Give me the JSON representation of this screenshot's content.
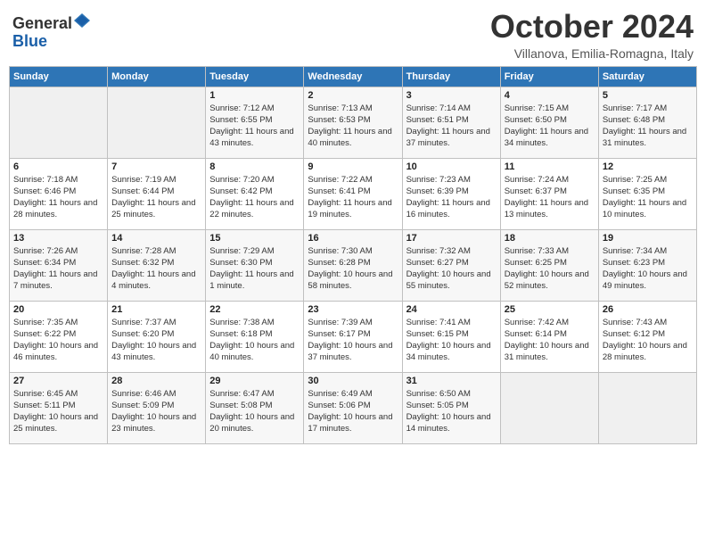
{
  "header": {
    "logo_general": "General",
    "logo_blue": "Blue",
    "month_title": "October 2024",
    "subtitle": "Villanova, Emilia-Romagna, Italy"
  },
  "weekdays": [
    "Sunday",
    "Monday",
    "Tuesday",
    "Wednesday",
    "Thursday",
    "Friday",
    "Saturday"
  ],
  "weeks": [
    [
      {
        "day": "",
        "empty": true
      },
      {
        "day": "",
        "empty": true
      },
      {
        "day": "1",
        "sunrise": "7:12 AM",
        "sunset": "6:55 PM",
        "daylight": "11 hours and 43 minutes."
      },
      {
        "day": "2",
        "sunrise": "7:13 AM",
        "sunset": "6:53 PM",
        "daylight": "11 hours and 40 minutes."
      },
      {
        "day": "3",
        "sunrise": "7:14 AM",
        "sunset": "6:51 PM",
        "daylight": "11 hours and 37 minutes."
      },
      {
        "day": "4",
        "sunrise": "7:15 AM",
        "sunset": "6:50 PM",
        "daylight": "11 hours and 34 minutes."
      },
      {
        "day": "5",
        "sunrise": "7:17 AM",
        "sunset": "6:48 PM",
        "daylight": "11 hours and 31 minutes."
      }
    ],
    [
      {
        "day": "6",
        "sunrise": "7:18 AM",
        "sunset": "6:46 PM",
        "daylight": "11 hours and 28 minutes."
      },
      {
        "day": "7",
        "sunrise": "7:19 AM",
        "sunset": "6:44 PM",
        "daylight": "11 hours and 25 minutes."
      },
      {
        "day": "8",
        "sunrise": "7:20 AM",
        "sunset": "6:42 PM",
        "daylight": "11 hours and 22 minutes."
      },
      {
        "day": "9",
        "sunrise": "7:22 AM",
        "sunset": "6:41 PM",
        "daylight": "11 hours and 19 minutes."
      },
      {
        "day": "10",
        "sunrise": "7:23 AM",
        "sunset": "6:39 PM",
        "daylight": "11 hours and 16 minutes."
      },
      {
        "day": "11",
        "sunrise": "7:24 AM",
        "sunset": "6:37 PM",
        "daylight": "11 hours and 13 minutes."
      },
      {
        "day": "12",
        "sunrise": "7:25 AM",
        "sunset": "6:35 PM",
        "daylight": "11 hours and 10 minutes."
      }
    ],
    [
      {
        "day": "13",
        "sunrise": "7:26 AM",
        "sunset": "6:34 PM",
        "daylight": "11 hours and 7 minutes."
      },
      {
        "day": "14",
        "sunrise": "7:28 AM",
        "sunset": "6:32 PM",
        "daylight": "11 hours and 4 minutes."
      },
      {
        "day": "15",
        "sunrise": "7:29 AM",
        "sunset": "6:30 PM",
        "daylight": "11 hours and 1 minute."
      },
      {
        "day": "16",
        "sunrise": "7:30 AM",
        "sunset": "6:28 PM",
        "daylight": "10 hours and 58 minutes."
      },
      {
        "day": "17",
        "sunrise": "7:32 AM",
        "sunset": "6:27 PM",
        "daylight": "10 hours and 55 minutes."
      },
      {
        "day": "18",
        "sunrise": "7:33 AM",
        "sunset": "6:25 PM",
        "daylight": "10 hours and 52 minutes."
      },
      {
        "day": "19",
        "sunrise": "7:34 AM",
        "sunset": "6:23 PM",
        "daylight": "10 hours and 49 minutes."
      }
    ],
    [
      {
        "day": "20",
        "sunrise": "7:35 AM",
        "sunset": "6:22 PM",
        "daylight": "10 hours and 46 minutes."
      },
      {
        "day": "21",
        "sunrise": "7:37 AM",
        "sunset": "6:20 PM",
        "daylight": "10 hours and 43 minutes."
      },
      {
        "day": "22",
        "sunrise": "7:38 AM",
        "sunset": "6:18 PM",
        "daylight": "10 hours and 40 minutes."
      },
      {
        "day": "23",
        "sunrise": "7:39 AM",
        "sunset": "6:17 PM",
        "daylight": "10 hours and 37 minutes."
      },
      {
        "day": "24",
        "sunrise": "7:41 AM",
        "sunset": "6:15 PM",
        "daylight": "10 hours and 34 minutes."
      },
      {
        "day": "25",
        "sunrise": "7:42 AM",
        "sunset": "6:14 PM",
        "daylight": "10 hours and 31 minutes."
      },
      {
        "day": "26",
        "sunrise": "7:43 AM",
        "sunset": "6:12 PM",
        "daylight": "10 hours and 28 minutes."
      }
    ],
    [
      {
        "day": "27",
        "sunrise": "6:45 AM",
        "sunset": "5:11 PM",
        "daylight": "10 hours and 25 minutes."
      },
      {
        "day": "28",
        "sunrise": "6:46 AM",
        "sunset": "5:09 PM",
        "daylight": "10 hours and 23 minutes."
      },
      {
        "day": "29",
        "sunrise": "6:47 AM",
        "sunset": "5:08 PM",
        "daylight": "10 hours and 20 minutes."
      },
      {
        "day": "30",
        "sunrise": "6:49 AM",
        "sunset": "5:06 PM",
        "daylight": "10 hours and 17 minutes."
      },
      {
        "day": "31",
        "sunrise": "6:50 AM",
        "sunset": "5:05 PM",
        "daylight": "10 hours and 14 minutes."
      },
      {
        "day": "",
        "empty": true
      },
      {
        "day": "",
        "empty": true
      }
    ]
  ],
  "labels": {
    "sunrise": "Sunrise:",
    "sunset": "Sunset:",
    "daylight": "Daylight:"
  }
}
